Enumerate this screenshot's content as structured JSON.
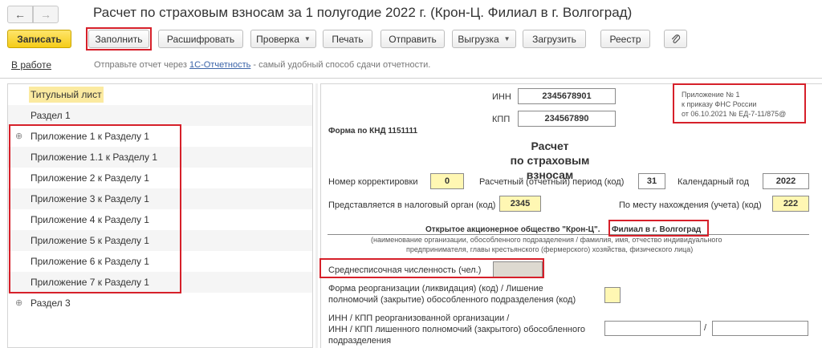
{
  "window": {
    "back_icon": "←",
    "forward_icon": "→",
    "title": "Расчет по страховым взносам за 1 полугодие 2022 г. (Крон-Ц. Филиал в г. Волгоград)"
  },
  "toolbar": {
    "save": "Записать",
    "fill": "Заполнить",
    "decode": "Расшифровать",
    "check": "Проверка",
    "print": "Печать",
    "send": "Отправить",
    "export": "Выгрузка",
    "load": "Загрузить",
    "registry": "Реестр",
    "attach_icon": "paperclip-icon"
  },
  "status": {
    "link": "В работе",
    "info_prefix": "Отправьте отчет через ",
    "info_link": "1С-Отчетность",
    "info_suffix": " - самый удобный способ сдачи отчетности."
  },
  "tree": {
    "items": [
      {
        "label": "Титульный лист"
      },
      {
        "label": "Раздел 1"
      },
      {
        "label": "Приложение 1 к Разделу 1"
      },
      {
        "label": "Приложение 1.1 к Разделу 1"
      },
      {
        "label": "Приложение 2 к Разделу 1"
      },
      {
        "label": "Приложение 3 к Разделу 1"
      },
      {
        "label": "Приложение 4 к Разделу 1"
      },
      {
        "label": "Приложение 5 к Разделу 1"
      },
      {
        "label": "Приложение 6 к Разделу 1"
      },
      {
        "label": "Приложение 7 к Разделу 1"
      },
      {
        "label": "Раздел 3"
      }
    ],
    "expander_icon": "⊕"
  },
  "form": {
    "inn_label": "ИНН",
    "inn_value": "2345678901",
    "kpp_label": "КПП",
    "kpp_value": "234567890",
    "appendix_line1": "Приложение № 1",
    "appendix_line2": "к приказу ФНС России",
    "appendix_line3": "от 06.10.2021 № ЕД-7-11/875@",
    "knd": "Форма по КНД 1151111",
    "title_line1": "Расчет",
    "title_line2": "по страховым взносам",
    "correction_label": "Номер корректировки",
    "correction_value": "0",
    "period_label": "Расчетный (отчетный) период (код)",
    "period_value": "31",
    "year_label": "Календарный год",
    "year_value": "2022",
    "tax_authority_label": "Представляется в налоговый орган (код)",
    "tax_authority_value": "2345",
    "location_label": "По месту нахождения (учета) (код)",
    "location_value": "222",
    "org_name": "Открытое акционерное общество \"Крон-Ц\".",
    "branch_name": "Филиал в г. Волгоград",
    "org_caption_line1": "(наименование организации, обособленного подразделения / фамилия, имя, отчество индивидуального",
    "org_caption_line2": "предпринимателя, главы крестьянского (фермерского) хозяйства, физического лица)",
    "headcount_label": "Среднесписочная численность (чел.)",
    "reorg_label_line1": "Форма реорганизации (ликвидация) (код) / Лишение",
    "reorg_label_line2": "полномочий (закрытие) обособленного подразделения (код)",
    "reorg_inn_line1": "ИНН / КПП реорганизованной организации /",
    "reorg_inn_line2": "ИНН / КПП лишенного полномочий (закрытого) обособленного",
    "reorg_inn_line3": "подразделения",
    "slash": "/"
  }
}
